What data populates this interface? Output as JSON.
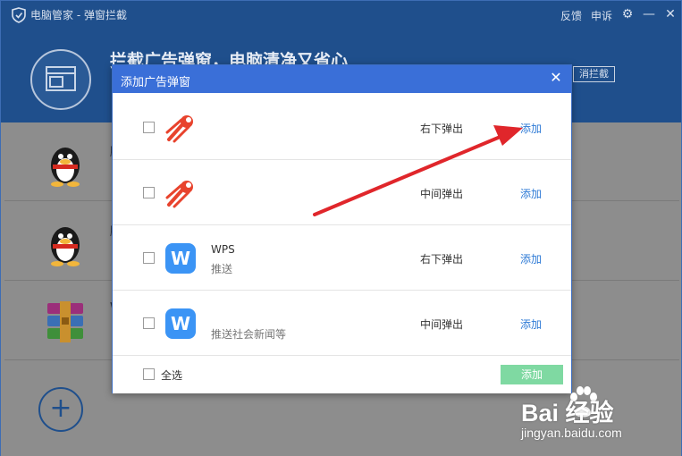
{
  "window": {
    "title": "电脑管家 - 弹窗拦截",
    "links": [
      "反馈",
      "申诉"
    ],
    "headline": "拦截广告弹窗，电脑清净又省心",
    "cancel_label": "消拦截"
  },
  "background_list": [
    {
      "icon": "qq-penguin-icon",
      "text": "腾"
    },
    {
      "icon": "qq-penguin-icon",
      "text": "腾"
    },
    {
      "icon": "winrar-icon",
      "text": "W"
    }
  ],
  "dialog": {
    "title": "添加广告弹窗",
    "rows": [
      {
        "icon": "comet-icon",
        "name": "",
        "desc": "",
        "position": "右下弹出",
        "action": "添加"
      },
      {
        "icon": "comet-icon",
        "name": "",
        "desc": "",
        "position": "中间弹出",
        "action": "添加"
      },
      {
        "icon": "wps-icon",
        "name": "WPS",
        "desc": "推送",
        "position": "右下弹出",
        "action": "添加"
      },
      {
        "icon": "wps-icon",
        "name": "",
        "desc": "推送社会新闻等",
        "position": "中间弹出",
        "action": "添加"
      }
    ],
    "select_all_label": "全选",
    "add_all_label": "添加"
  },
  "watermark": {
    "brand": "Bai 经验",
    "url": "jingyan.baidu.com"
  },
  "colors": {
    "title_bar": "#1f4f8c",
    "dialog_header": "#3a6fd8",
    "link_blue": "#2f7bd6",
    "add_button_green": "#7fd9a2",
    "arrow_red": "#e0262b"
  }
}
